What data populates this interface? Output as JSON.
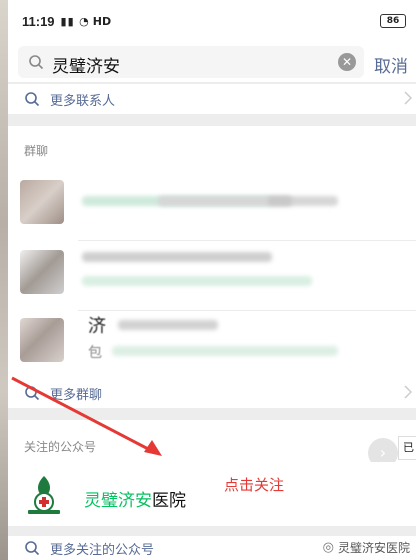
{
  "status_bar": {
    "time": "11:19",
    "signal_text": "HD",
    "battery": "86"
  },
  "search": {
    "query": "灵璧济安",
    "cancel_label": "取消"
  },
  "contacts": {
    "more_label": "更多联系人"
  },
  "groups": {
    "title": "群聊",
    "more_label": "更多群聊",
    "partial_chars": [
      "济",
      "包"
    ]
  },
  "official_accounts": {
    "title": "关注的公众号",
    "account_name_highlight": "灵璧济安",
    "account_name_rest": "医院",
    "followed_badge": "已",
    "more_label": "更多关注的公众号"
  },
  "annotation": {
    "text": "点击关注",
    "color": "#e53935"
  },
  "watermark": {
    "text": "灵璧济安医院"
  },
  "colors": {
    "link_blue": "#576b95",
    "highlight_green": "#07c160",
    "annotation_red": "#e53935"
  }
}
